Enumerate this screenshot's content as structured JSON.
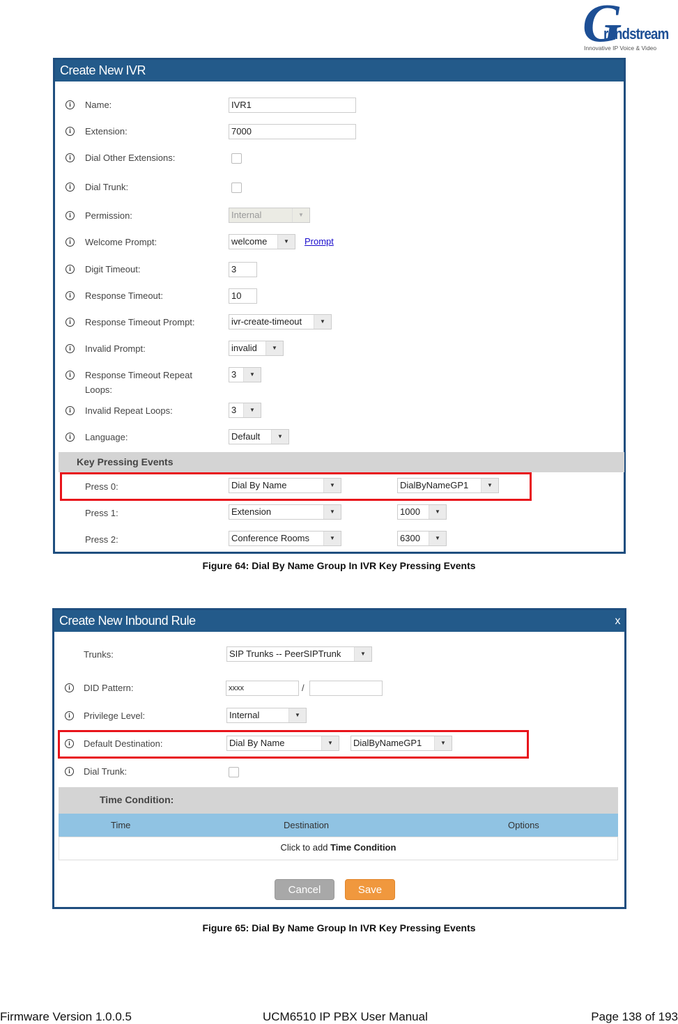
{
  "logo": {
    "letter": "G",
    "word": "randstream",
    "tagline": "Innovative IP Voice & Video"
  },
  "figure64": {
    "title": "Create New IVR",
    "fields": [
      {
        "label": "Name:",
        "type": "text",
        "value": "IVR1"
      },
      {
        "label": "Extension:",
        "type": "text",
        "value": "7000"
      },
      {
        "label": "Dial Other Extensions:",
        "type": "checkbox",
        "checked": false
      },
      {
        "label": "Dial Trunk:",
        "type": "checkbox",
        "checked": false
      },
      {
        "label": "Permission:",
        "type": "select",
        "value": "Internal",
        "disabled": true
      },
      {
        "label": "Welcome Prompt:",
        "type": "select",
        "value": "welcome",
        "link": "Prompt"
      },
      {
        "label": "Digit Timeout:",
        "type": "text",
        "value": "3"
      },
      {
        "label": "Response Timeout:",
        "type": "text",
        "value": "10"
      },
      {
        "label": "Response Timeout Prompt:",
        "type": "select",
        "value": "ivr-create-timeout"
      },
      {
        "label": "Invalid Prompt:",
        "type": "select",
        "value": "invalid"
      },
      {
        "label": "Response Timeout Repeat",
        "label2": "Loops:",
        "type": "select",
        "value": "3"
      },
      {
        "label": "Invalid Repeat Loops:",
        "type": "select",
        "value": "3"
      },
      {
        "label": "Language:",
        "type": "select",
        "value": "Default"
      }
    ],
    "section_title": "Key Pressing Events",
    "key_events": [
      {
        "label": "Press 0:",
        "type": "Dial By Name",
        "target": "DialByNameGP1"
      },
      {
        "label": "Press 1:",
        "type": "Extension",
        "target": "1000"
      },
      {
        "label": "Press 2:",
        "type": "Conference Rooms",
        "target": "6300"
      }
    ],
    "caption": "Figure 64: Dial By Name Group In IVR Key Pressing Events"
  },
  "figure65": {
    "title": "Create New Inbound Rule",
    "close_label": "x",
    "trunks_label": "Trunks:",
    "trunks_value": "SIP Trunks -- PeerSIPTrunk",
    "did_label": "DID Pattern:",
    "did_value": "xxxx",
    "did_separator": "/",
    "did_value2": "",
    "privilege_label": "Privilege Level:",
    "privilege_value": "Internal",
    "default_dest_label": "Default Destination:",
    "default_dest_type": "Dial By Name",
    "default_dest_target": "DialByNameGP1",
    "dial_trunk_label": "Dial Trunk:",
    "time_condition_title": "Time Condition:",
    "table_headers": [
      "Time",
      "Destination",
      "Options"
    ],
    "table_empty_prefix": "Click to add ",
    "table_empty_bold": "Time Condition",
    "cancel_label": "Cancel",
    "save_label": "Save",
    "caption": "Figure 65: Dial By Name Group In IVR Key Pressing Events"
  },
  "footer": {
    "left": "Firmware Version 1.0.0.5",
    "center": "UCM6510 IP PBX User Manual",
    "right": "Page 138 of 193"
  },
  "colors": {
    "header": "#235a8a",
    "highlight": "#e8141b",
    "save": "#f0983e",
    "table_header": "#90c3e3"
  }
}
